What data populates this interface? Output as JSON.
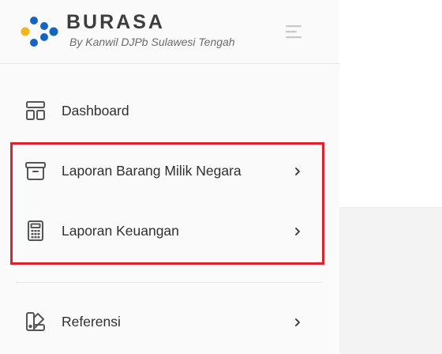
{
  "brand": {
    "title": "BURASA",
    "subtitle": "By Kanwil DJPb Sulawesi Tengah",
    "logo_colors": {
      "blue": "#1565c0",
      "yellow": "#f2b51c"
    }
  },
  "header": {
    "menu_icon": "hamburger-icon"
  },
  "sidebar": {
    "items": [
      {
        "label": "Dashboard",
        "icon": "layout-dashboard-icon",
        "has_submenu": false
      },
      {
        "label": "Laporan Barang Milik Negara",
        "icon": "archive-box-icon",
        "has_submenu": true
      },
      {
        "label": "Laporan Keuangan",
        "icon": "calculator-icon",
        "has_submenu": true
      },
      {
        "label": "Referensi",
        "icon": "swatch-book-icon",
        "has_submenu": true
      }
    ]
  },
  "colors": {
    "highlight_border": "#e0202a",
    "icon": "#555555",
    "text": "#2f2f2f"
  }
}
